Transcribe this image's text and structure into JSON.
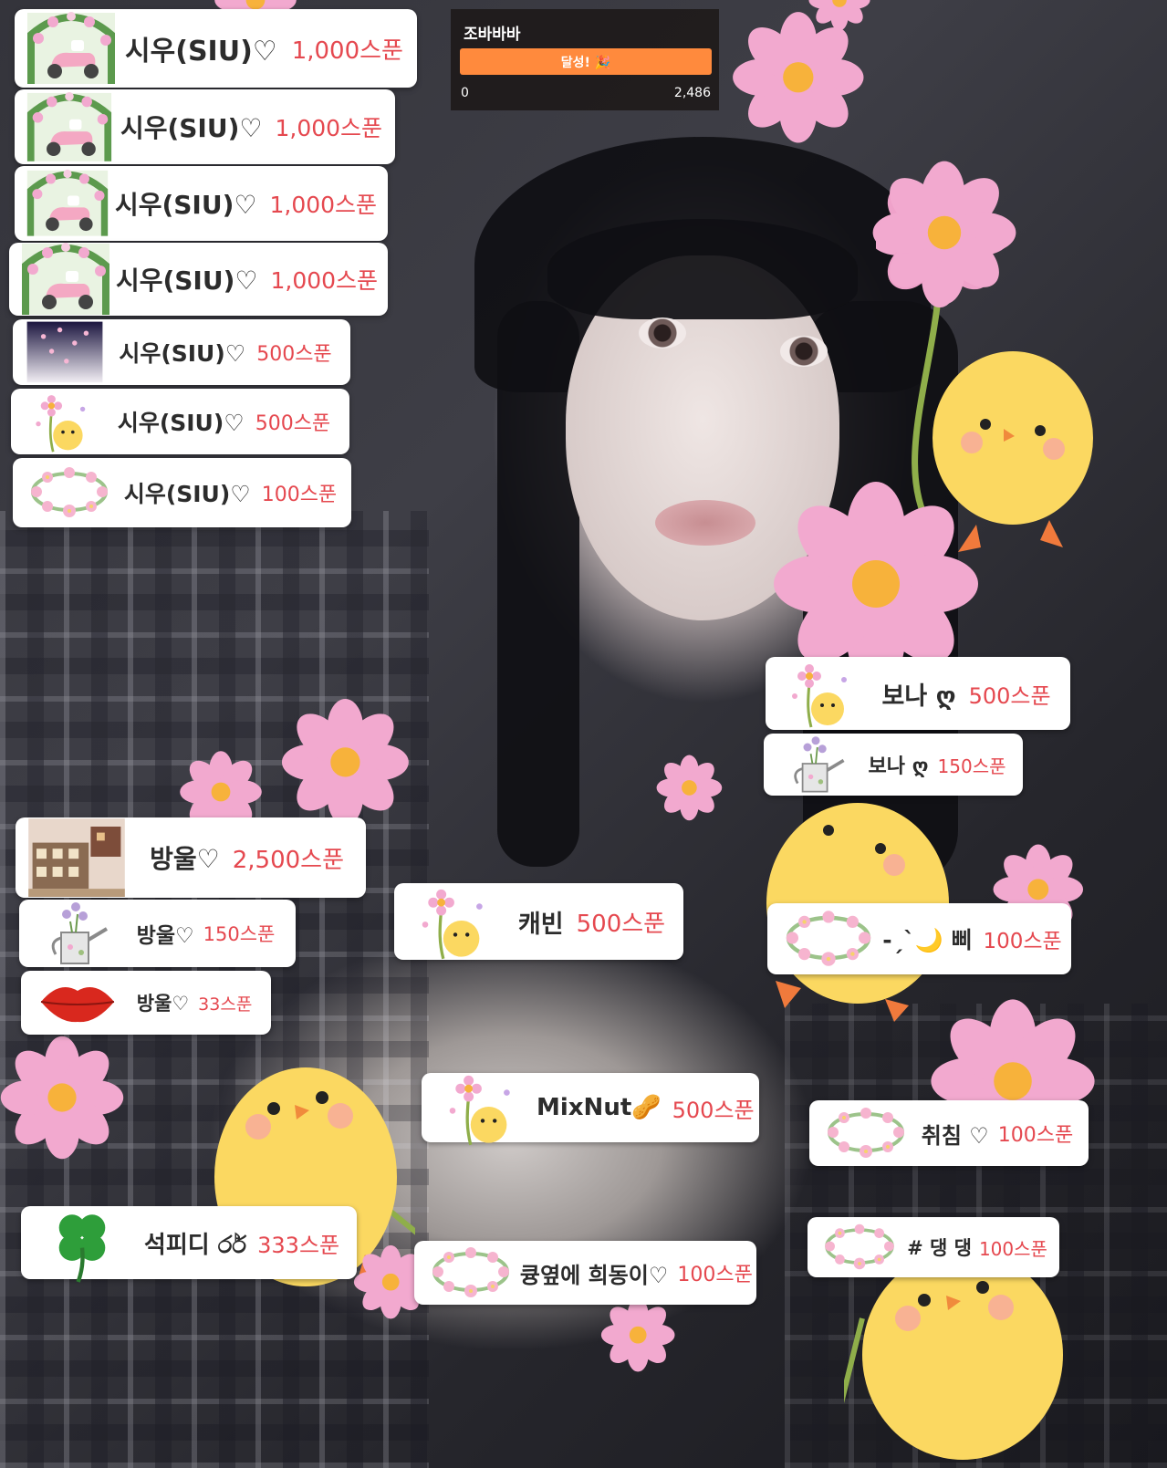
{
  "goal_widget": {
    "title": "조바바바",
    "bar_label": "달성! 🎉",
    "progress": 1.0,
    "min_label": "0",
    "max_label": "2,486",
    "bar_color": "#ff8a3d"
  },
  "donations": [
    {
      "name": "시우(SIU)♡",
      "amount": "1,000스푼",
      "gift_icon": "pink-scooter-flower-arch-icon"
    },
    {
      "name": "시우(SIU)♡",
      "amount": "1,000스푼",
      "gift_icon": "pink-scooter-flower-arch-icon"
    },
    {
      "name": "시우(SIU)♡",
      "amount": "1,000스푼",
      "gift_icon": "pink-scooter-flower-arch-icon"
    },
    {
      "name": "시우(SIU)♡",
      "amount": "1,000스푼",
      "gift_icon": "pink-scooter-flower-arch-icon"
    },
    {
      "name": "시우(SIU)♡",
      "amount": "500스푼",
      "gift_icon": "falling-petals-night-icon"
    },
    {
      "name": "시우(SIU)♡",
      "amount": "500스푼",
      "gift_icon": "chick-with-flower-icon"
    },
    {
      "name": "시우(SIU)♡",
      "amount": "100스푼",
      "gift_icon": "flower-wreath-icon"
    },
    {
      "name": "보나 ღ",
      "amount": "500스푼",
      "gift_icon": "chick-with-flower-icon"
    },
    {
      "name": "보나 ღ",
      "amount": "150스푼",
      "gift_icon": "flower-watering-can-icon"
    },
    {
      "name": "방울♡",
      "amount": "2,500스푼",
      "gift_icon": "building-scene-icon"
    },
    {
      "name": "방울♡",
      "amount": "150스푼",
      "gift_icon": "flower-watering-can-icon"
    },
    {
      "name": "방울♡",
      "amount": "33스푼",
      "gift_icon": "red-lips-icon"
    },
    {
      "name": "캐빈",
      "amount": "500스푼",
      "gift_icon": "chick-with-flower-icon"
    },
    {
      "name": "-ˏˋ🌙 삐",
      "amount": "100스푼",
      "gift_icon": "flower-wreath-icon"
    },
    {
      "name": "MixNut🥜",
      "amount": "500스푼",
      "gift_icon": "chick-with-flower-icon"
    },
    {
      "name": "취침 ♡",
      "amount": "100스푼",
      "gift_icon": "flower-wreath-icon"
    },
    {
      "name": "석피디 ර්ර",
      "amount": "333스푼",
      "gift_icon": "four-leaf-clover-icon"
    },
    {
      "name": "큥옆에 희동이♡",
      "amount": "100스푼",
      "gift_icon": "flower-wreath-icon"
    },
    {
      "name": "# 댕 댕",
      "amount": "100스푼",
      "gift_icon": "flower-wreath-icon"
    }
  ],
  "colors": {
    "amount": "#e5484f",
    "name": "#2c2c2c",
    "card_bg": "#ffffff",
    "flower_petal": "#f2a9cf",
    "flower_center": "#f7b23b",
    "chick": "#fbd861"
  }
}
